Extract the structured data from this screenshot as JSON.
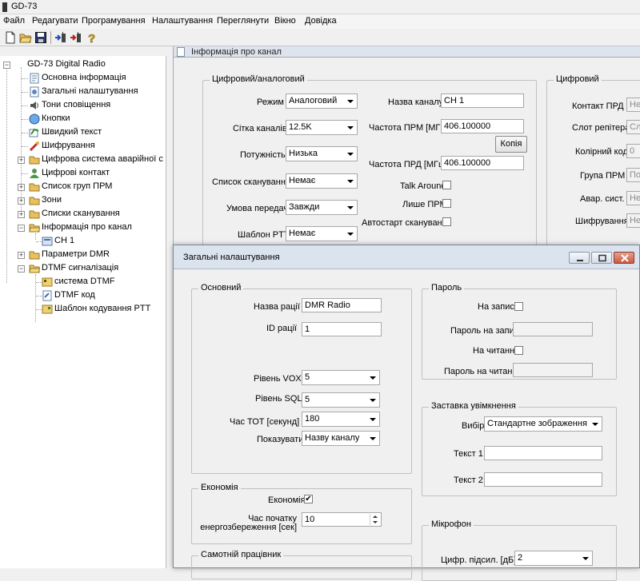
{
  "app": {
    "title": "GD-73"
  },
  "menu": [
    "Файл",
    "Редагувати",
    "Програмування",
    "Налаштування",
    "Переглянути",
    "Вікно",
    "Довідка"
  ],
  "toolbar": {
    "icons": [
      "new-file-icon",
      "open-folder-icon",
      "save-icon",
      "read-radio-icon",
      "write-radio-icon",
      "help-icon"
    ]
  },
  "tree": {
    "root": "GD-73 Digital Radio",
    "items": [
      "Основна інформація",
      "Загальні налаштування",
      "Тони сповіщення",
      "Кнопки",
      "Швидкий текст",
      "Шифрування",
      "Цифрова система аварійної с",
      "Цифрові контакт",
      "Список груп ПРМ",
      "Зони",
      "Списки сканування",
      "Інформація про канал",
      "CH 1",
      "Параметри DMR",
      "DTMF сигналізація",
      "система DTMF",
      "DTMF код",
      "Шаблон кодування PTT"
    ]
  },
  "channel": {
    "header": "Інформація про канал",
    "group_da": "Цифровий/аналоговий",
    "mode_label": "Режим",
    "mode_value": "Аналоговий",
    "spacing_label": "Сітка каналів",
    "spacing_value": "12.5K",
    "power_label": "Потужність",
    "power_value": "Низька",
    "scanlist_label": "Список сканування",
    "scanlist_value": "Немає",
    "txcond_label": "Умова передачі",
    "txcond_value": "Завжди",
    "ptt_label": "Шаблон PTT",
    "ptt_value": "Немає",
    "name_label": "Назва каналу",
    "name_value": "CH 1",
    "rx_label": "Частота ПРМ [МГц]",
    "rx_value": "406.100000",
    "copy_btn": "Копія",
    "tx_label": "Частота ПРД [МГц]",
    "tx_value": "406.100000",
    "talkaround_label": "Talk Around",
    "rxonly_label": "Лише ПРМ",
    "autoscan_label": "Автостарт сканування",
    "group_digital": "Цифровий",
    "contact_label": "Контакт ПРД",
    "contact_value": "Нем",
    "slot_label": "Слот репітера",
    "slot_value": "Слот",
    "cc_label": "Колірний код",
    "cc_value": "0",
    "rxgroup_label": "Група ПРМ",
    "rxgroup_value": "Пот",
    "emerg_label": "Авар. сист.",
    "emerg_value": "Нем",
    "enc_label": "Шифрування",
    "enc_value": "Нем"
  },
  "general": {
    "title": "Загальні налаштування",
    "group_basic": "Основний",
    "radio_name_label": "Назва рації",
    "radio_name_value": "DMR Radio",
    "radio_id_label": "ID рації",
    "radio_id_value": "1",
    "vox_label": "Рівень VOX",
    "vox_value": "5",
    "sql_label": "Рівень SQL",
    "sql_value": "5",
    "tot_label": "Час ТОТ [секунд]",
    "tot_value": "180",
    "show_label": "Показувати",
    "show_value": "Назву каналу",
    "group_password": "Пароль",
    "write_label": "На запис",
    "write_pwd_label": "Пароль на запис",
    "read_label": "На читання",
    "read_pwd_label": "Пароль на читання",
    "group_splash": "Заставка увімкнення",
    "choice_label": "Вибір",
    "choice_value": "Стандартне зображення",
    "text1_label": "Текст 1",
    "text2_label": "Текст 2",
    "group_economy": "Економія",
    "economy_label": "Економія",
    "economy_checked": "✔",
    "eco_start_label_1": "Час початку",
    "eco_start_label_2": "енергозбереження [сек]",
    "eco_start_value": "10",
    "group_lone": "Самотній працівник",
    "group_mic": "Мікрофон",
    "mic_gain_label": "Цифр. підсил. [дБ]",
    "mic_gain_value": "2"
  }
}
